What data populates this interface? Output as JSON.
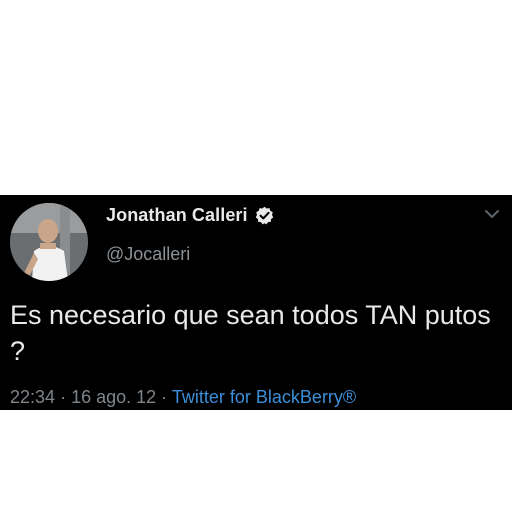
{
  "tweet": {
    "display_name": "Jonathan Calleri",
    "handle": "@Jocalleri",
    "verified_icon": "verified-badge-icon",
    "text": "Es necesario que sean todos TAN putos ?",
    "time": "22:34",
    "separator": "·",
    "date": "16 ago. 12",
    "source": "Twitter for BlackBerry®",
    "colors": {
      "background": "#000000",
      "name": "#e7e9ea",
      "secondary": "#8b9196",
      "link": "#3b8fd9"
    }
  }
}
